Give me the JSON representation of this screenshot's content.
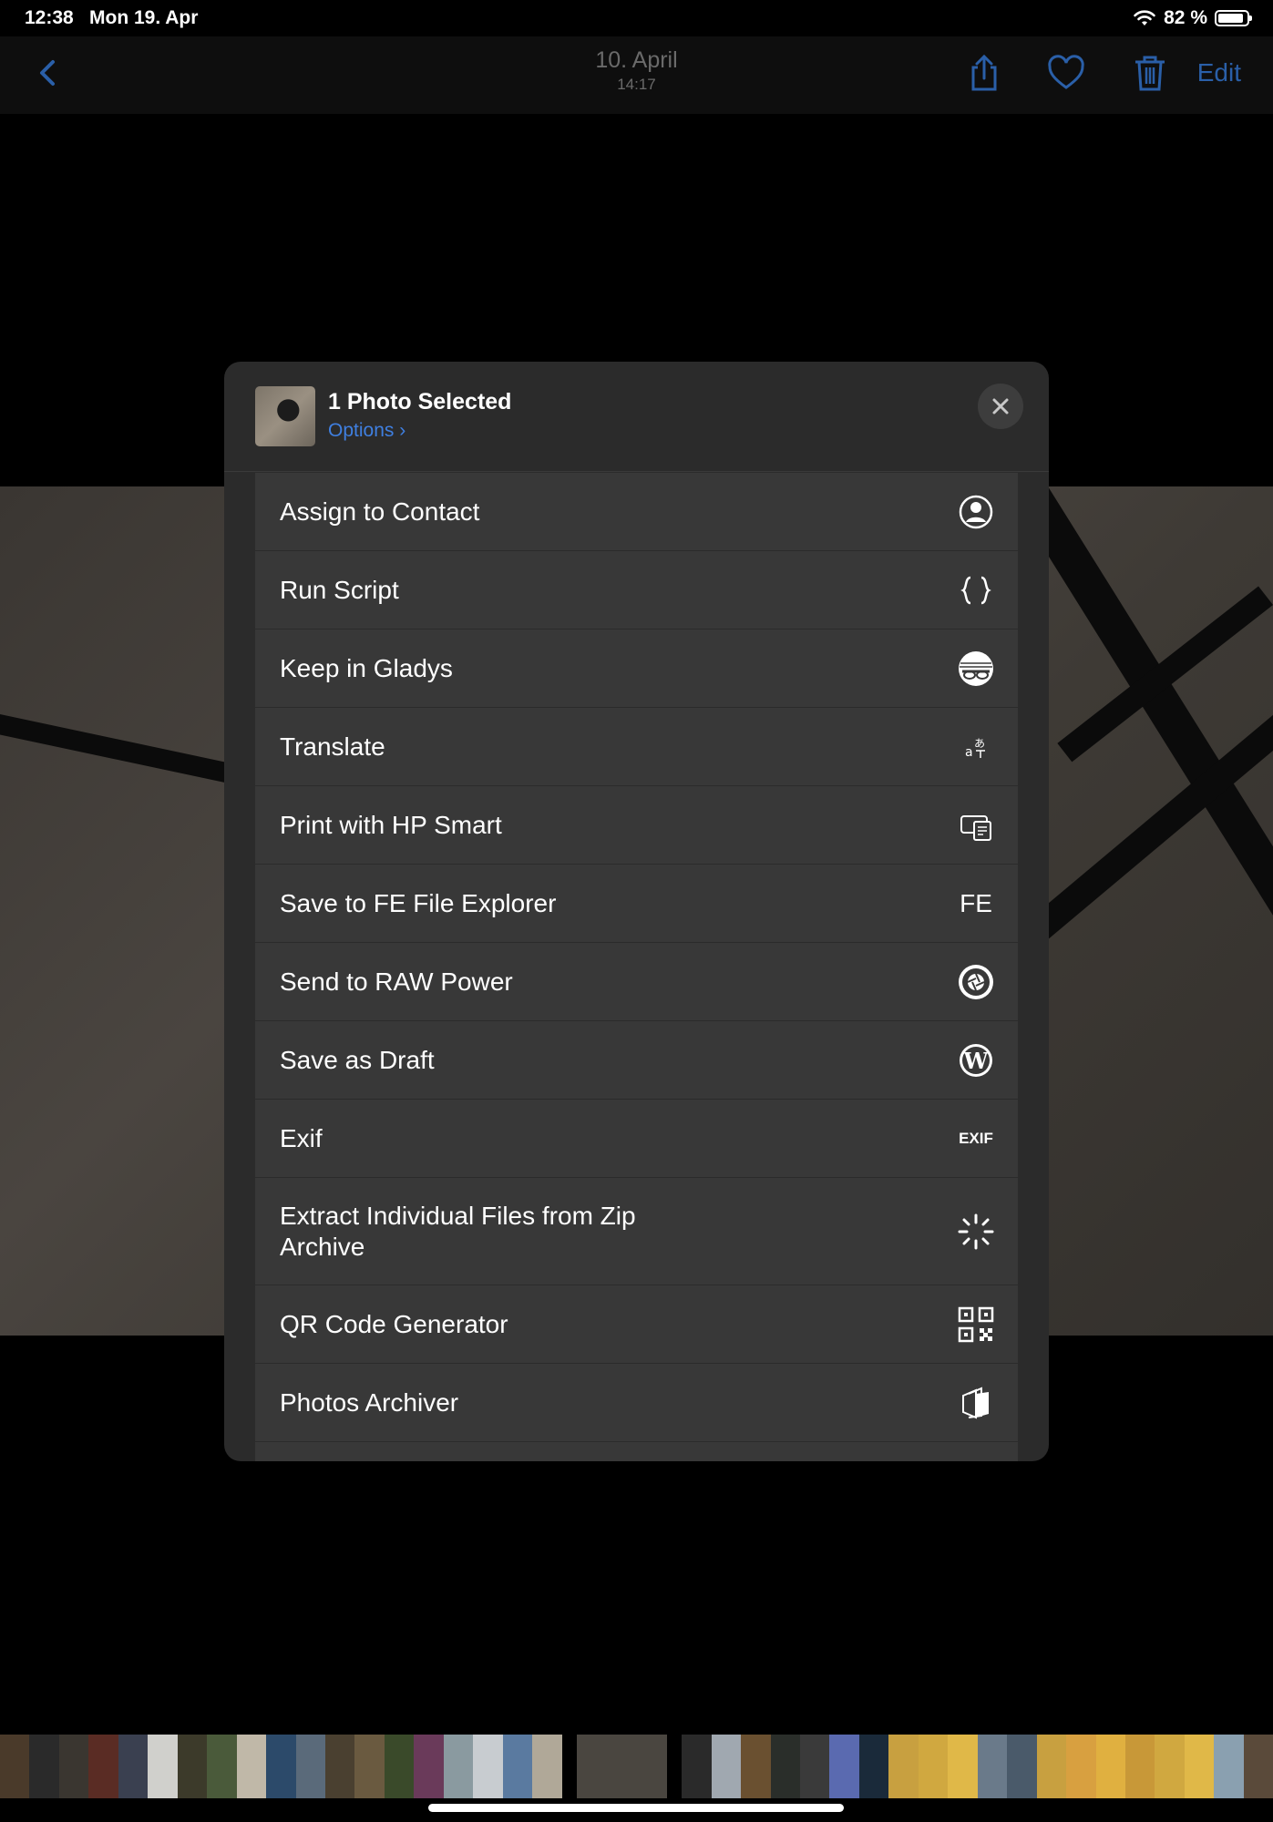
{
  "status_bar": {
    "time": "12:38",
    "date": "Mon 19. Apr",
    "battery": "82 %",
    "battery_level": 0.82
  },
  "navbar": {
    "title": "10. April",
    "subtitle": "14:17",
    "edit_label": "Edit",
    "icons": [
      "back-chevron-icon",
      "share-icon",
      "heart-icon",
      "trash-icon"
    ]
  },
  "share_sheet": {
    "title": "1 Photo Selected",
    "options_label": "Options",
    "actions": [
      {
        "label": "Assign to Contact",
        "icon": "contact-icon"
      },
      {
        "label": "Run Script",
        "icon": "braces-icon"
      },
      {
        "label": "Keep in Gladys",
        "icon": "gladys-icon"
      },
      {
        "label": "Translate",
        "icon": "translate-icon"
      },
      {
        "label": "Print with HP Smart",
        "icon": "printer-icon"
      },
      {
        "label": "Save to FE File Explorer",
        "icon": "fe-icon",
        "glyph": "FE"
      },
      {
        "label": "Send to RAW Power",
        "icon": "aperture-icon"
      },
      {
        "label": "Save as Draft",
        "icon": "wordpress-icon"
      },
      {
        "label": "Exif",
        "icon": "exif-icon",
        "glyph": "EXIF"
      },
      {
        "label": "Extract Individual Files from Zip Archive",
        "icon": "spinner-icon"
      },
      {
        "label": "QR Code Generator",
        "icon": "qr-code-icon"
      },
      {
        "label": "Photos Archiver",
        "icon": "archive-icon"
      }
    ]
  },
  "colors": {
    "accent": "#3f7fe0",
    "nav_tint": "#2a5fa8",
    "row_bg": "#383838",
    "sheet_bg": "#2b2b2b"
  }
}
